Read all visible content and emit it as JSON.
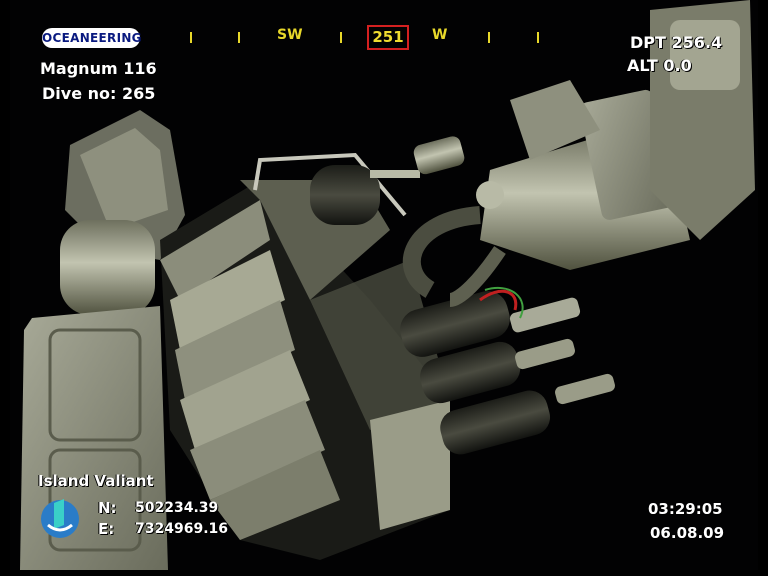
{
  "overlay": {
    "logo": "OCEANEERING",
    "rov_name": "Magnum 116",
    "dive_label": "Dive no: 265",
    "heading": {
      "left_label": "SW",
      "value": "251",
      "right_label": "W"
    },
    "depth": "DPT 256.4",
    "altitude": "ALT  0.0",
    "vessel": "Island Valiant",
    "north_label": "N:",
    "north_value": "502234.39",
    "east_label": "E:",
    "east_value": "7324969.16",
    "time": "03:29:05",
    "date": "06.08.09"
  },
  "colors": {
    "heading_text": "#e8d82a",
    "heading_box": "#d42020",
    "background": "#020203",
    "metal": "#8a8d7a"
  },
  "icons": [
    "ship-logo-icon"
  ]
}
